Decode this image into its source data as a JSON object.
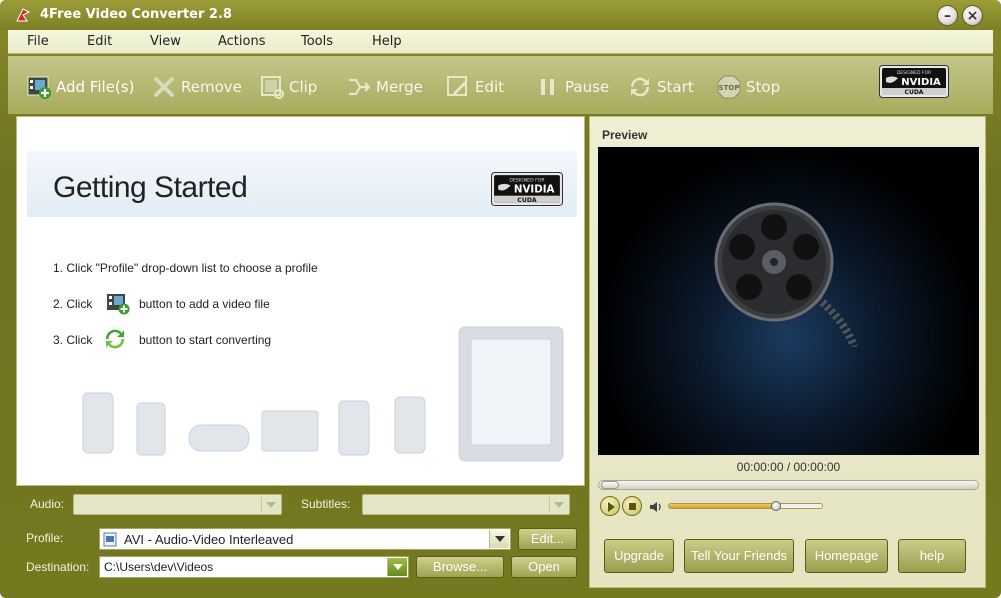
{
  "window": {
    "title": "4Free Video Converter 2.8",
    "minimize_label": "–",
    "close_label": "×"
  },
  "menu": [
    "File",
    "Edit",
    "View",
    "Actions",
    "Tools",
    "Help"
  ],
  "toolbar": {
    "add_files": "Add File(s)",
    "remove": "Remove",
    "clip": "Clip",
    "merge": "Merge",
    "edit": "Edit",
    "pause": "Pause",
    "start": "Start",
    "stop": "Stop",
    "badge_lines": [
      "DESIGNED FOR",
      "NVIDIA",
      "CUDA"
    ]
  },
  "getting_started": {
    "title": "Getting Started",
    "step1": "1. Click \"Profile\" drop-down list to choose a profile",
    "step2_prefix": "2. Click",
    "step2_suffix": "button to add a video file",
    "step3_prefix": "3. Click",
    "step3_suffix": "button to start converting"
  },
  "audio": {
    "label": "Audio:",
    "value": ""
  },
  "subtitles": {
    "label": "Subtitles:",
    "value": ""
  },
  "profile": {
    "label": "Profile:",
    "value": "AVI - Audio-Video Interleaved",
    "edit_button": "Edit..."
  },
  "destination": {
    "label": "Destination:",
    "value": "C:\\Users\\dev\\Videos",
    "browse_button": "Browse...",
    "open_button": "Open"
  },
  "preview": {
    "label": "Preview",
    "timecode": "00:00:00 / 00:00:00",
    "seek_position": 0,
    "volume_level": 0.7
  },
  "bottom_buttons": {
    "upgrade": "Upgrade",
    "tell_friends": "Tell Your Friends",
    "homepage": "Homepage",
    "help": "help"
  },
  "colors": {
    "frame": "#74781f",
    "toolbar": "#a8ab5c",
    "menubar": "#eef0d2",
    "preview_bg": "#000000",
    "accent_green": "#6a9a23"
  }
}
